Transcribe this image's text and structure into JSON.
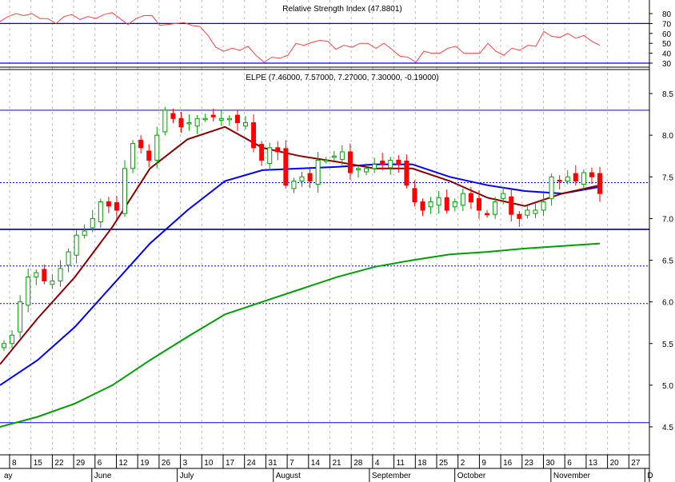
{
  "chart_data": {
    "type": "candlestick",
    "title": "ELPE (7.46000, 7.57000, 7.27000, 7.30000, -0.19000)",
    "ticker": "ELPE",
    "price_axis": {
      "range": [
        4.5,
        8.5
      ],
      "ticks": [
        "8.5",
        "8.0",
        "7.5",
        "7.0",
        "6.5",
        "6.0",
        "5.5",
        "5.0",
        "4.5"
      ]
    },
    "horizontal_levels": [
      {
        "value": 8.3,
        "style": "solid"
      },
      {
        "value": 7.43,
        "style": "dashed"
      },
      {
        "value": 6.87,
        "style": "solid-dark"
      },
      {
        "value": 6.43,
        "style": "dashed"
      },
      {
        "value": 5.98,
        "style": "dashed"
      },
      {
        "value": 4.55,
        "style": "solid"
      }
    ],
    "closes": [
      5.5,
      5.6,
      6.0,
      6.3,
      6.35,
      6.25,
      6.25,
      6.4,
      6.6,
      6.8,
      6.85,
      7.0,
      7.2,
      7.15,
      7.1,
      7.6,
      7.9,
      7.85,
      7.7,
      8.0,
      8.3,
      8.2,
      8.1,
      8.15,
      8.2,
      8.2,
      8.22,
      8.2,
      8.2,
      8.15,
      8.15,
      7.85,
      7.7,
      7.85,
      7.8,
      7.4,
      7.45,
      7.5,
      7.45,
      7.7,
      7.7,
      7.75,
      7.8,
      7.55,
      7.6,
      7.6,
      7.65,
      7.65,
      7.7,
      7.65,
      7.4,
      7.2,
      7.1,
      7.2,
      7.25,
      7.1,
      7.2,
      7.3,
      7.2,
      7.1,
      7.05,
      7.2,
      7.3,
      7.05,
      7.0,
      7.1,
      7.1,
      7.2,
      7.5,
      7.45,
      7.5,
      7.45,
      7.55,
      7.5,
      7.3
    ],
    "ma_short": [
      5.25,
      5.8,
      6.3,
      6.9,
      7.6,
      7.95,
      8.1,
      7.85,
      7.75,
      7.68,
      7.6,
      7.6,
      7.45,
      7.25,
      7.15,
      7.3,
      7.4
    ],
    "ma_medium": [
      5.0,
      5.3,
      5.7,
      6.2,
      6.7,
      7.1,
      7.45,
      7.58,
      7.6,
      7.62,
      7.65,
      7.65,
      7.5,
      7.4,
      7.33,
      7.3,
      7.38
    ],
    "ma_long": [
      4.5,
      4.62,
      4.78,
      5.0,
      5.3,
      5.58,
      5.85,
      6.0,
      6.15,
      6.3,
      6.42,
      6.5,
      6.57,
      6.6,
      6.64,
      6.67,
      6.7
    ],
    "rsi": {
      "title": "Relative Strength Index (47.8801)",
      "ticks": [
        "80",
        "70",
        "60",
        "50",
        "40",
        "30"
      ],
      "levels": [
        70,
        30
      ],
      "values": [
        72,
        77,
        80,
        78,
        80,
        75,
        75,
        70,
        77,
        79,
        74,
        77,
        75,
        79,
        81,
        75,
        69,
        75,
        78,
        78,
        68,
        69,
        70,
        71,
        68,
        67,
        58,
        46,
        42,
        45,
        43,
        47,
        38,
        31,
        36,
        35,
        38,
        50,
        48,
        51,
        53,
        52,
        44,
        48,
        46,
        50,
        50,
        45,
        50,
        44,
        37,
        36,
        31,
        42,
        40,
        40,
        45,
        47,
        40,
        40,
        40,
        50,
        42,
        38,
        45,
        43,
        48,
        47,
        62,
        57,
        56,
        60,
        55,
        58,
        52,
        48
      ]
    },
    "x_axis": {
      "days": [
        "8",
        "15",
        "22",
        "29",
        "6",
        "12",
        "19",
        "26",
        "3",
        "10",
        "17",
        "24",
        "31",
        "7",
        "14",
        "21",
        "28",
        "4",
        "11",
        "18",
        "25",
        "2",
        "9",
        "16",
        "23",
        "30",
        "6",
        "13",
        "20",
        "27"
      ],
      "months": [
        {
          "label": "ay",
          "at": 0
        },
        {
          "label": "June",
          "at": 4
        },
        {
          "label": "July",
          "at": 8
        },
        {
          "label": "August",
          "at": 12.5
        },
        {
          "label": "September",
          "at": 17
        },
        {
          "label": "October",
          "at": 21
        },
        {
          "label": "November",
          "at": 25.5
        },
        {
          "label": "D",
          "at": 29.9
        }
      ]
    },
    "colors": {
      "up": "#00a000",
      "down": "#ff0000",
      "ma_short": "#8b0000",
      "ma_medium": "#0000ff",
      "ma_long": "#00a000",
      "rsi": "#ff4040",
      "level": "#0000ff"
    }
  }
}
